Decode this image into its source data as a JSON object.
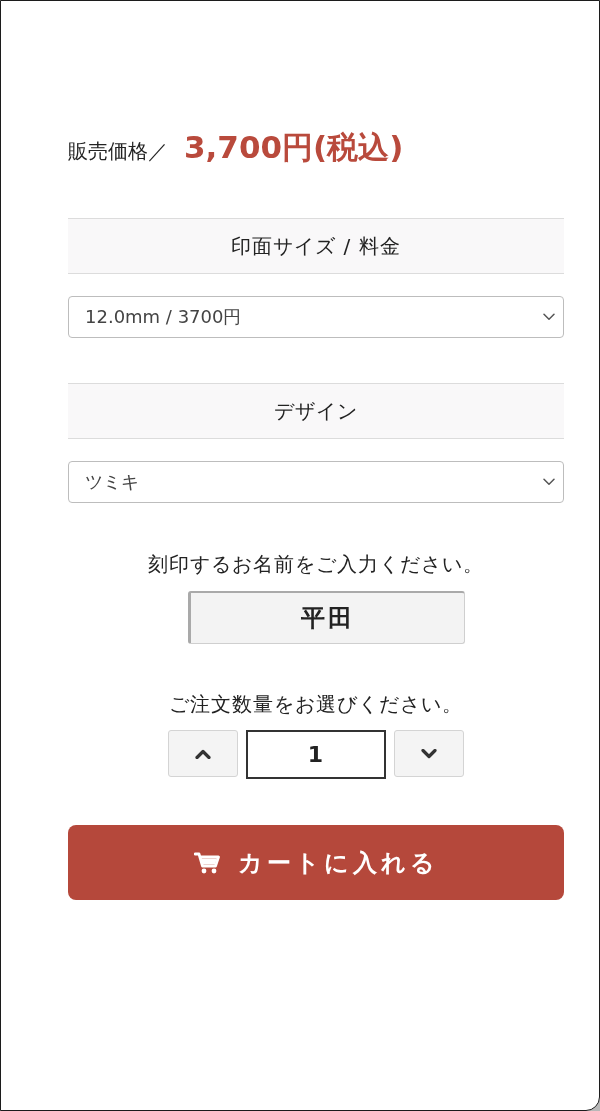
{
  "price": {
    "label": "販売価格／",
    "value": "3,700円(税込)"
  },
  "options": [
    {
      "heading": "印面サイズ / 料金",
      "selected_value": "12.0mm / 3700円"
    },
    {
      "heading": "デザイン",
      "selected_value": "ツミキ"
    }
  ],
  "name_field": {
    "prompt": "刻印するお名前をご入力ください。",
    "value": "平田"
  },
  "quantity": {
    "prompt": "ご注文数量をお選びください。",
    "value": "1"
  },
  "cart_button": {
    "label": "カートに入れる"
  }
}
